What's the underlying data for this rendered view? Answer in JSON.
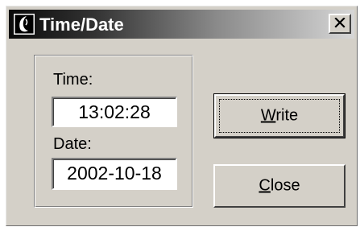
{
  "window": {
    "title": "Time/Date",
    "close_glyph": "✕"
  },
  "time": {
    "label": "Time:",
    "value": "13:02:28"
  },
  "date": {
    "label": "Date:",
    "value": "2002-10-18"
  },
  "buttons": {
    "write": {
      "mnemonic": "W",
      "rest": "rite"
    },
    "close": {
      "mnemonic": "C",
      "rest": "lose"
    }
  },
  "icons": {
    "app": "app-logo-icon",
    "close": "close-icon"
  }
}
